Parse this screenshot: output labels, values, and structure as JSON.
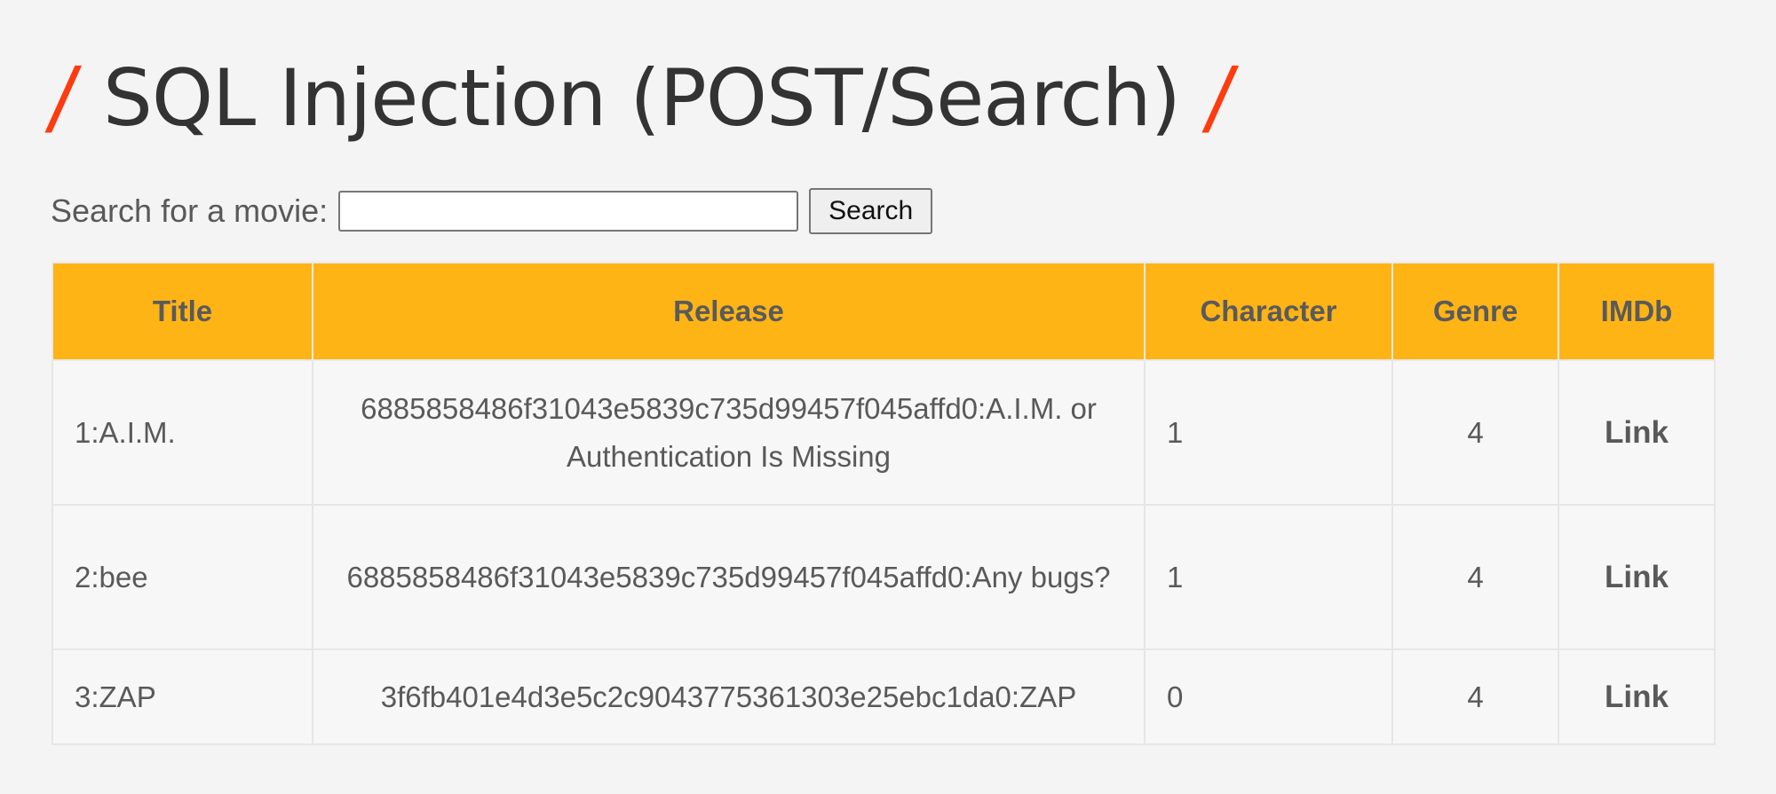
{
  "page": {
    "title": "SQL Injection (POST/Search)",
    "title_slash": "/"
  },
  "search": {
    "label": "Search for a movie:",
    "input_value": "",
    "input_placeholder": "",
    "button_label": "Search"
  },
  "table": {
    "headers": [
      "Title",
      "Release",
      "Character",
      "Genre",
      "IMDb"
    ],
    "rows": [
      {
        "title": "1:A.I.M.",
        "release": "6885858486f31043e5839c735d99457f045affd0:A.I.M. or Authentication Is Missing",
        "character": "1",
        "genre": "4",
        "imdb": "Link"
      },
      {
        "title": "2:bee",
        "release": "6885858486f31043e5839c735d99457f045affd0:Any bugs?",
        "character": "1",
        "genre": "4",
        "imdb": "Link"
      },
      {
        "title": "3:ZAP",
        "release": "3f6fb401e4d3e5c2c9043775361303e25ebc1da0:ZAP",
        "character": "0",
        "genre": "4",
        "imdb": "Link"
      }
    ]
  },
  "colors": {
    "accent_slash": "#ff3b0f",
    "header_background": "#ffb416",
    "page_background": "#f4f4f4"
  }
}
